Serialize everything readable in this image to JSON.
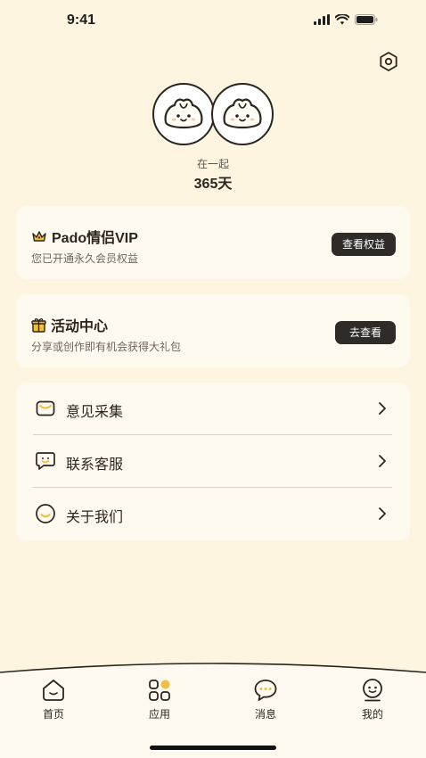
{
  "status_bar": {
    "time": "9:41"
  },
  "profile": {
    "together_label": "在一起",
    "days": "365天"
  },
  "vip_card": {
    "title": "Pado情侣VIP",
    "desc": "您已开通永久会员权益",
    "button": "查看权益"
  },
  "activity_card": {
    "title": "活动中心",
    "desc": "分享或创作即有机会获得大礼包",
    "button": "去查看"
  },
  "menu": [
    {
      "label": "意见采集",
      "icon": "mail-icon"
    },
    {
      "label": "联系客服",
      "icon": "chat-smile-icon"
    },
    {
      "label": "关于我们",
      "icon": "smile-icon"
    }
  ],
  "tabbar": [
    {
      "label": "首页",
      "icon": "home-icon"
    },
    {
      "label": "应用",
      "icon": "apps-icon"
    },
    {
      "label": "消息",
      "icon": "message-icon"
    },
    {
      "label": "我的",
      "icon": "profile-icon"
    }
  ],
  "colors": {
    "background": "#FDF5E0",
    "card": "#FFFAEF",
    "button": "#2F2B29",
    "accent": "#F1BF3B"
  }
}
